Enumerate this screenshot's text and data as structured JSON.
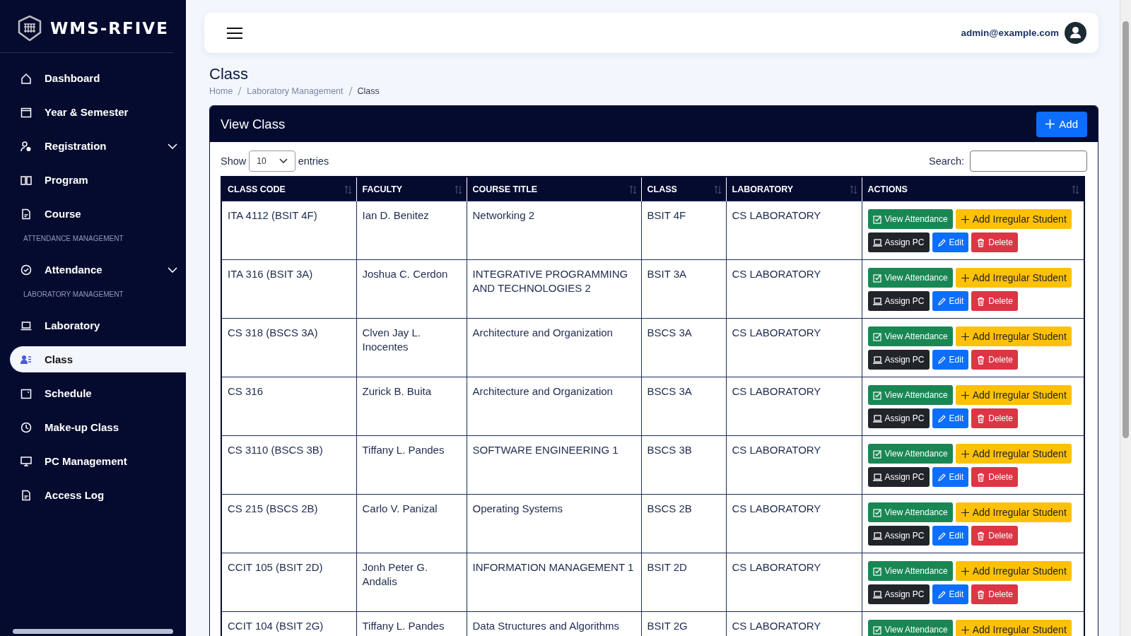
{
  "brand": "WMS-RFIVE",
  "sidebar": {
    "items": [
      {
        "kind": "item",
        "label": "Dashboard",
        "selected": false
      },
      {
        "kind": "item",
        "label": "Year & Semester",
        "selected": false
      },
      {
        "kind": "item",
        "label": "Registration",
        "selected": false,
        "submenu": true
      },
      {
        "kind": "item",
        "label": "Program",
        "selected": false
      },
      {
        "kind": "item",
        "label": "Course",
        "selected": false
      },
      {
        "kind": "section",
        "label": "ATTENDANCE MANAGEMENT"
      },
      {
        "kind": "item",
        "label": "Attendance",
        "selected": false,
        "submenu": true
      },
      {
        "kind": "section",
        "label": "LABORATORY MANAGEMENT"
      },
      {
        "kind": "item",
        "label": "Laboratory",
        "selected": false
      },
      {
        "kind": "item",
        "label": "Class",
        "selected": true
      },
      {
        "kind": "item",
        "label": "Schedule",
        "selected": false
      },
      {
        "kind": "item",
        "label": "Make-up Class",
        "selected": false
      },
      {
        "kind": "item",
        "label": "PC Management",
        "selected": false
      },
      {
        "kind": "item",
        "label": "Access Log",
        "selected": false
      }
    ]
  },
  "topbar": {
    "user": "admin@example.com"
  },
  "page": {
    "title": "Class",
    "breadcrumb": [
      "Home",
      "Laboratory Management",
      "Class"
    ]
  },
  "card": {
    "title": "View Class",
    "add_button": "Add",
    "show_label": "Show",
    "entries_value": "10",
    "entries_label": "entries",
    "search_label": "Search:"
  },
  "table": {
    "columns": [
      "CLASS CODE",
      "FACULTY",
      "COURSE TITLE",
      "CLASS",
      "LABORATORY",
      "ACTIONS"
    ],
    "rows": [
      {
        "cells": [
          "ITA 4112 (BSIT 4F)",
          "Ian D. Benitez",
          "Networking 2",
          "BSIT 4F",
          "CS LABORATORY"
        ],
        "actions": [
          {
            "kind": "view",
            "label": "View Attendance"
          },
          {
            "kind": "irregular",
            "label": "Add Irregular Student"
          },
          {
            "kind": "assign",
            "label": "Assign PC"
          },
          {
            "kind": "edit",
            "label": "Edit"
          },
          {
            "kind": "delete",
            "label": "Delete"
          }
        ]
      },
      {
        "cells": [
          "ITA 316 (BSIT 3A)",
          "Joshua C. Cerdon",
          "INTEGRATIVE PROGRAMMING AND TECHNOLOGIES 2",
          "BSIT 3A",
          "CS LABORATORY"
        ],
        "actions": [
          {
            "kind": "view",
            "label": "View Attendance"
          },
          {
            "kind": "irregular",
            "label": "Add Irregular Student"
          },
          {
            "kind": "assign",
            "label": "Assign PC"
          },
          {
            "kind": "edit",
            "label": "Edit"
          },
          {
            "kind": "delete",
            "label": "Delete"
          }
        ]
      },
      {
        "cells": [
          "CS 318 (BSCS 3A)",
          "Clven Jay L. Inocentes",
          "Architecture and Organization",
          "BSCS 3A",
          "CS LABORATORY"
        ],
        "actions": [
          {
            "kind": "view",
            "label": "View Attendance"
          },
          {
            "kind": "irregular",
            "label": "Add Irregular Student"
          },
          {
            "kind": "assign",
            "label": "Assign PC"
          },
          {
            "kind": "edit",
            "label": "Edit"
          },
          {
            "kind": "delete",
            "label": "Delete"
          }
        ]
      },
      {
        "cells": [
          "CS 316",
          "Zurick B. Buita",
          "Architecture and Organization",
          "BSCS 3A",
          "CS LABORATORY"
        ],
        "actions": [
          {
            "kind": "view",
            "label": "View Attendance"
          },
          {
            "kind": "irregular",
            "label": "Add Irregular Student"
          },
          {
            "kind": "assign",
            "label": "Assign PC"
          },
          {
            "kind": "edit",
            "label": "Edit"
          },
          {
            "kind": "delete",
            "label": "Delete"
          }
        ]
      },
      {
        "cells": [
          "CS 3110 (BSCS 3B)",
          "Tiffany L. Pandes",
          "SOFTWARE ENGINEERING 1",
          "BSCS 3B",
          "CS LABORATORY"
        ],
        "actions": [
          {
            "kind": "view",
            "label": "View Attendance"
          },
          {
            "kind": "irregular",
            "label": "Add Irregular Student"
          },
          {
            "kind": "assign",
            "label": "Assign PC"
          },
          {
            "kind": "edit",
            "label": "Edit"
          },
          {
            "kind": "delete",
            "label": "Delete"
          }
        ]
      },
      {
        "cells": [
          "CS 215 (BSCS 2B)",
          "Carlo V. Panizal",
          "Operating Systems",
          "BSCS 2B",
          "CS LABORATORY"
        ],
        "actions": [
          {
            "kind": "view",
            "label": "View Attendance"
          },
          {
            "kind": "irregular",
            "label": "Add Irregular Student"
          },
          {
            "kind": "assign",
            "label": "Assign PC"
          },
          {
            "kind": "edit",
            "label": "Edit"
          },
          {
            "kind": "delete",
            "label": "Delete"
          }
        ]
      },
      {
        "cells": [
          "CCIT 105 (BSIT 2D)",
          "Jonh Peter G. Andalis",
          "INFORMATION MANAGEMENT 1",
          "BSIT 2D",
          "CS LABORATORY"
        ],
        "actions": [
          {
            "kind": "view",
            "label": "View Attendance"
          },
          {
            "kind": "irregular",
            "label": "Add Irregular Student"
          },
          {
            "kind": "assign",
            "label": "Assign PC"
          },
          {
            "kind": "edit",
            "label": "Edit"
          },
          {
            "kind": "delete",
            "label": "Delete"
          }
        ]
      },
      {
        "cells": [
          "CCIT 104 (BSIT 2G)",
          "Tiffany L. Pandes",
          "Data Structures and Algorithms",
          "BSIT 2G",
          "CS LABORATORY"
        ],
        "actions": [
          {
            "kind": "view",
            "label": "View Attendance"
          },
          {
            "kind": "irregular",
            "label": "Add Irregular Student"
          }
        ]
      }
    ]
  }
}
